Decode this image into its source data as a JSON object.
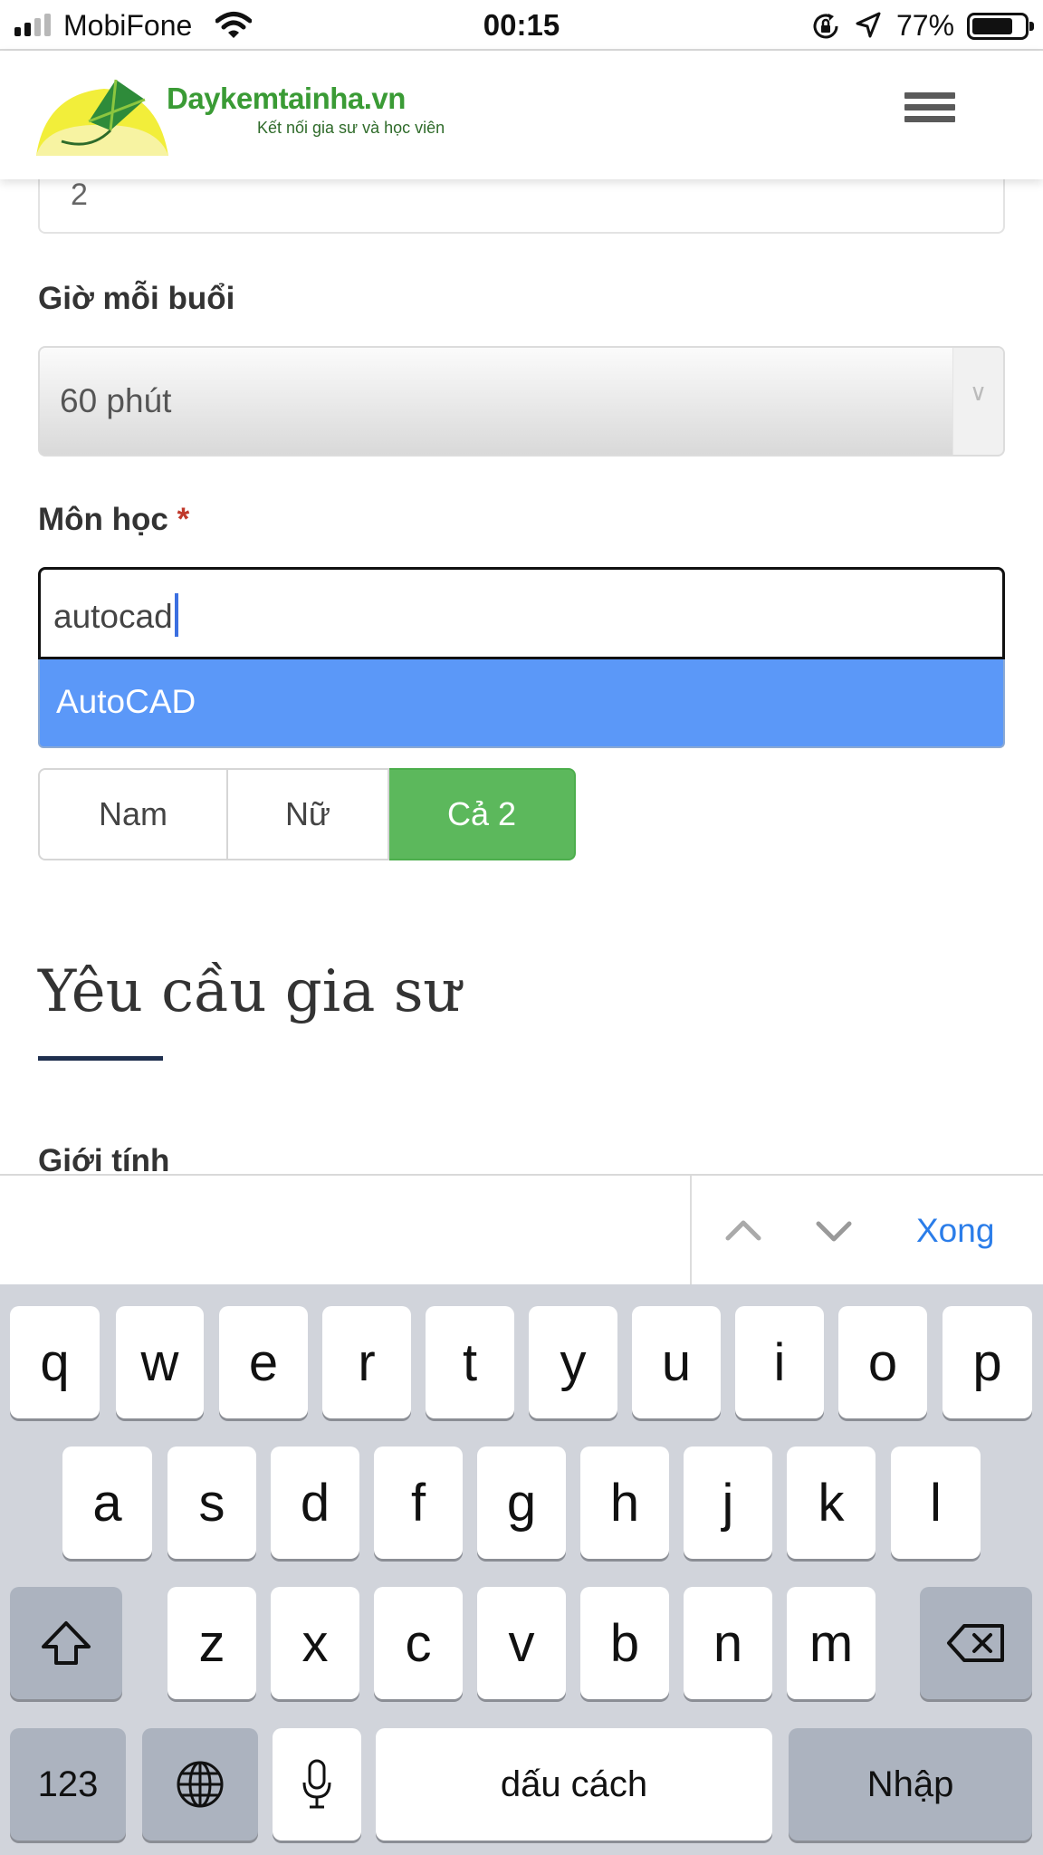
{
  "status_bar": {
    "carrier": "MobiFone",
    "time": "00:15",
    "battery_percent": "77%",
    "battery_level": 0.77,
    "signal_bars": 2
  },
  "header": {
    "logo_name": "Daykemtainha.vn",
    "logo_tagline": "Kết nối gia sư và học viên"
  },
  "form": {
    "previous_field_value": "2",
    "hours_label": "Giờ mỗi buổi",
    "hours_value": "60 phút",
    "subject_label": "Môn học",
    "subject_required_mark": "*",
    "subject_value": "autocad",
    "suggestion": "AutoCAD",
    "gender_options": [
      "Nam",
      "Nữ",
      "Cả 2"
    ],
    "gender_selected": "Cả 2",
    "section_title": "Yêu cầu gia sư",
    "next_label": "Giới tính"
  },
  "accessory_bar": {
    "done_label": "Xong"
  },
  "keyboard": {
    "row1": [
      "q",
      "w",
      "e",
      "r",
      "t",
      "y",
      "u",
      "i",
      "o",
      "p"
    ],
    "row2": [
      "a",
      "s",
      "d",
      "f",
      "g",
      "h",
      "j",
      "k",
      "l"
    ],
    "row3": [
      "z",
      "x",
      "c",
      "v",
      "b",
      "n",
      "m"
    ],
    "numbers_label": "123",
    "space_label": "dấu cách",
    "return_label": "Nhập"
  },
  "colors": {
    "suggestion_bg": "#5b98f8",
    "selected_button": "#5cb85c",
    "done_text": "#2b7de9",
    "required": "#c0392b",
    "logo_green": "#3a9b35"
  }
}
